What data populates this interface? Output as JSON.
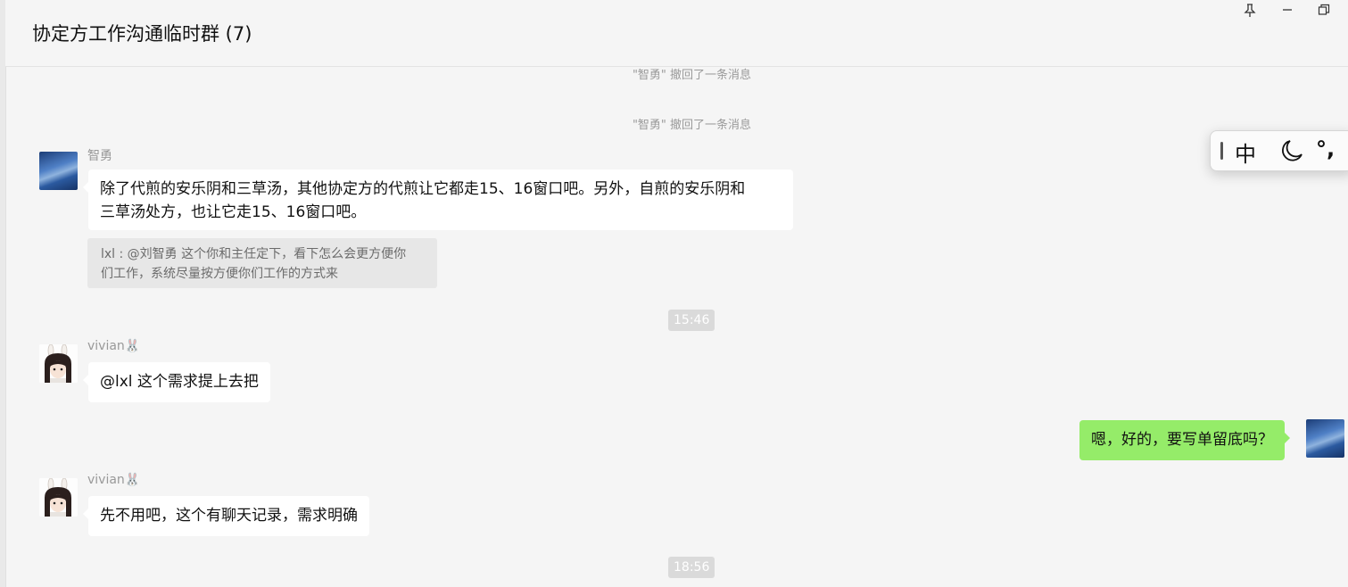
{
  "header": {
    "title": "协定方工作沟通临时群 (7)",
    "pin_icon": "pin-icon",
    "minimize_icon": "minimize-icon",
    "restore_icon": "restore-icon"
  },
  "ime": {
    "mode": "中",
    "punctuation": "°,",
    "moon_icon": "moon-icon"
  },
  "messages": [
    {
      "type": "system",
      "text": "\"智勇\" 撤回了一条消息"
    },
    {
      "type": "system",
      "text": "\"智勇\" 撤回了一条消息"
    },
    {
      "type": "incoming",
      "sender": "智勇",
      "lines": [
        "除了代煎的安乐阴和三草汤，其他协定方的代煎让它都走15、16窗口吧。另外，自煎的安乐阴和",
        "三草汤处方，也让它走15、16窗口吧。"
      ],
      "quote_lines": [
        "lxl : @刘智勇 这个你和主任定下，看下怎么会更方便你",
        "们工作，系统尽量按方便你们工作的方式来"
      ]
    },
    {
      "type": "time",
      "text": "15:46"
    },
    {
      "type": "incoming",
      "sender": "vivian🐰",
      "text": "@lxl 这个需求提上去把"
    },
    {
      "type": "outgoing",
      "text": "嗯，好的，要写单留底吗？"
    },
    {
      "type": "incoming",
      "sender": "vivian🐰",
      "text": "先不用吧，这个有聊天记录，需求明确"
    },
    {
      "type": "time",
      "text": "18:56"
    }
  ],
  "colors": {
    "background": "#f5f5f5",
    "outgoing_bubble": "#95ec69",
    "incoming_bubble": "#ffffff",
    "time_badge": "#dadada"
  }
}
